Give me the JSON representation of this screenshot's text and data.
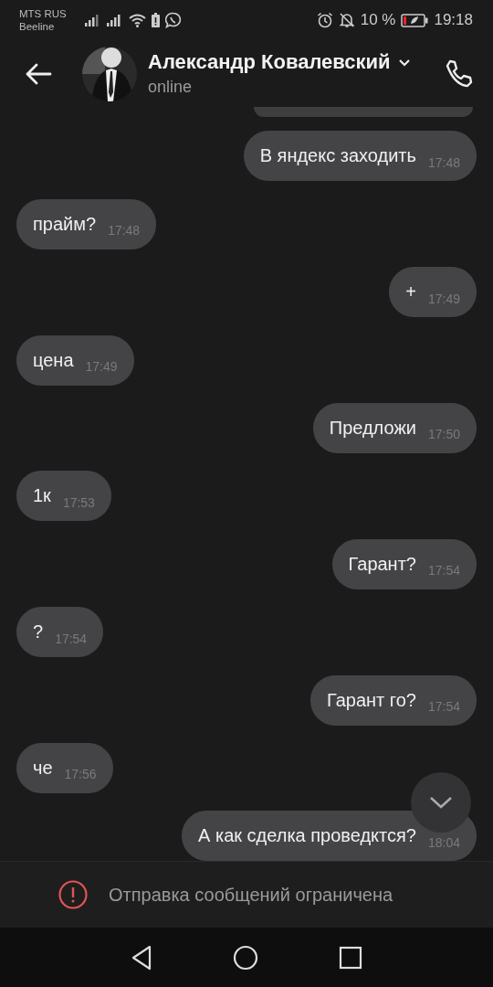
{
  "status_bar": {
    "carrier_1": "MTS RUS",
    "carrier_2": "Beeline",
    "battery": "10 %",
    "time": "19:18"
  },
  "header": {
    "name": "Александр Ковалевский",
    "status": "online"
  },
  "messages": [
    {
      "kind": "outgoing",
      "cut": true
    },
    {
      "kind": "outgoing",
      "text": "В яндекс заходить",
      "time": "17:48"
    },
    {
      "kind": "incoming",
      "text": "прайм?",
      "time": "17:48"
    },
    {
      "kind": "outgoing",
      "text": "+",
      "time": "17:49"
    },
    {
      "kind": "incoming",
      "text": "цена",
      "time": "17:49"
    },
    {
      "kind": "outgoing",
      "text": "Предложи",
      "time": "17:50"
    },
    {
      "kind": "incoming",
      "text": "1к",
      "time": "17:53"
    },
    {
      "kind": "outgoing",
      "text": "Гарант?",
      "time": "17:54"
    },
    {
      "kind": "incoming",
      "text": "?",
      "time": "17:54"
    },
    {
      "kind": "outgoing",
      "text": "Гарант го?",
      "time": "17:54"
    },
    {
      "kind": "incoming",
      "text": "че",
      "time": "17:56"
    },
    {
      "kind": "outgoing",
      "text": "А как сделка проведктся?",
      "time": "18:04"
    }
  ],
  "notice": {
    "text": "Отправка сообщений ограничена"
  }
}
